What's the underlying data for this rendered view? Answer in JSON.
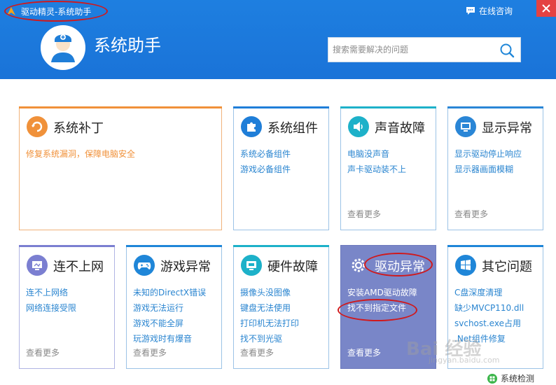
{
  "window": {
    "title": "驱动精灵-系统助手"
  },
  "header": {
    "consult_label": "在线咨询",
    "main_title": "系统助手",
    "search": {
      "placeholder": "搜索需要解决的问题"
    }
  },
  "cards": [
    {
      "title": "系统补丁",
      "icon": "patch-icon",
      "color": "#f0913a",
      "links": [
        "修复系统漏洞，保障电脑安全"
      ],
      "more": ""
    },
    {
      "title": "系统组件",
      "icon": "puzzle-icon",
      "color": "#1f7ed8",
      "links": [
        "系统必备组件",
        "游戏必备组件"
      ],
      "more": ""
    },
    {
      "title": "声音故障",
      "icon": "speaker-icon",
      "color": "#1db1c9",
      "links": [
        "电脑没声音",
        "声卡驱动装不上"
      ],
      "more": "查看更多"
    },
    {
      "title": "显示异常",
      "icon": "monitor-icon",
      "color": "#2a86d6",
      "links": [
        "显示驱动停止响应",
        "显示器画面模糊"
      ],
      "more": "查看更多"
    },
    {
      "title": "连不上网",
      "icon": "network-icon",
      "color": "#7b7fd1",
      "links": [
        "连不上网络",
        "网络连接受限"
      ],
      "more": "查看更多"
    },
    {
      "title": "游戏异常",
      "icon": "gamepad-icon",
      "color": "#1f86d8",
      "links": [
        "未知的DirectX错误",
        "游戏无法运行",
        "游戏不能全屏",
        "玩游戏时有爆音"
      ],
      "more": "查看更多"
    },
    {
      "title": "硬件故障",
      "icon": "hardware-icon",
      "color": "#1db1c9",
      "links": [
        "摄像头没图像",
        "键盘无法使用",
        "打印机无法打印",
        "找不到光驱"
      ],
      "more": "查看更多"
    },
    {
      "title": "驱动异常",
      "icon": "driver-gear-icon",
      "color": "#7986c8",
      "links": [
        "安装AMD驱动故障",
        "找不到指定文件"
      ],
      "more": "查看更多"
    },
    {
      "title": "其它问题",
      "icon": "windows-icon",
      "color": "#1f86d8",
      "links": [
        "C盘深度清理",
        "缺少MVCP110.dll",
        "svchost.exe占用",
        ".Net组件修复"
      ],
      "more": ""
    }
  ],
  "watermark": {
    "text": "Bai 经验",
    "sub": "jingyan.baidu.com"
  },
  "footer": {
    "system_check_label": "系统检测"
  }
}
